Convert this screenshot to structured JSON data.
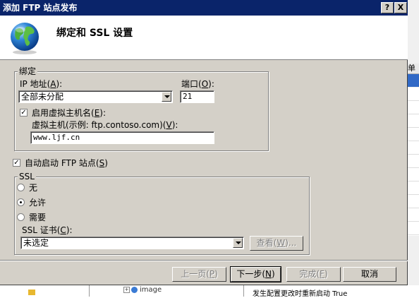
{
  "window": {
    "title": "添加 FTP 站点发布",
    "help_label": "?",
    "close_label": "X"
  },
  "header": {
    "title": "绑定和 SSL 设置"
  },
  "binding": {
    "legend": "绑定",
    "ip_label_main": "IP 地址(",
    "ip_label_key": "A",
    "ip_label_end": "):",
    "ip_value": "全部未分配",
    "port_label_main": "端口(",
    "port_label_key": "O",
    "port_label_end": "):",
    "port_value": "21",
    "vhost_checkbox_main": "启用虚拟主机名(",
    "vhost_checkbox_key": "E",
    "vhost_checkbox_end": "):",
    "vhost_checked": true,
    "vhost_label_main": "虚拟主机(示例: ftp.contoso.com)(",
    "vhost_label_key": "V",
    "vhost_label_end": "):",
    "vhost_value": "www.ljf.cn"
  },
  "autostart": {
    "label_main": "自动启动 FTP 站点(",
    "label_key": "S",
    "label_end": ")",
    "checked": true
  },
  "ssl": {
    "legend": "SSL",
    "options": [
      "无",
      "允许",
      "需要"
    ],
    "selected": "允许",
    "cert_label_main": "SSL 证书(",
    "cert_label_key": "C",
    "cert_label_end": "):",
    "cert_value": "未选定",
    "view_button_main": "查看(",
    "view_button_key": "W",
    "view_button_end": ")..."
  },
  "footer": {
    "prev_main": "上一页(",
    "prev_key": "P",
    "prev_end": ")",
    "next_main": "下一步(",
    "next_key": "N",
    "next_end": ")",
    "finish_main": "完成(",
    "finish_key": "F",
    "finish_end": ")",
    "cancel": "取消"
  },
  "background": {
    "right_header": "单",
    "tree_item": "image",
    "tree_expander": "+",
    "status_text": "发生配置更改时重新启动   True"
  }
}
